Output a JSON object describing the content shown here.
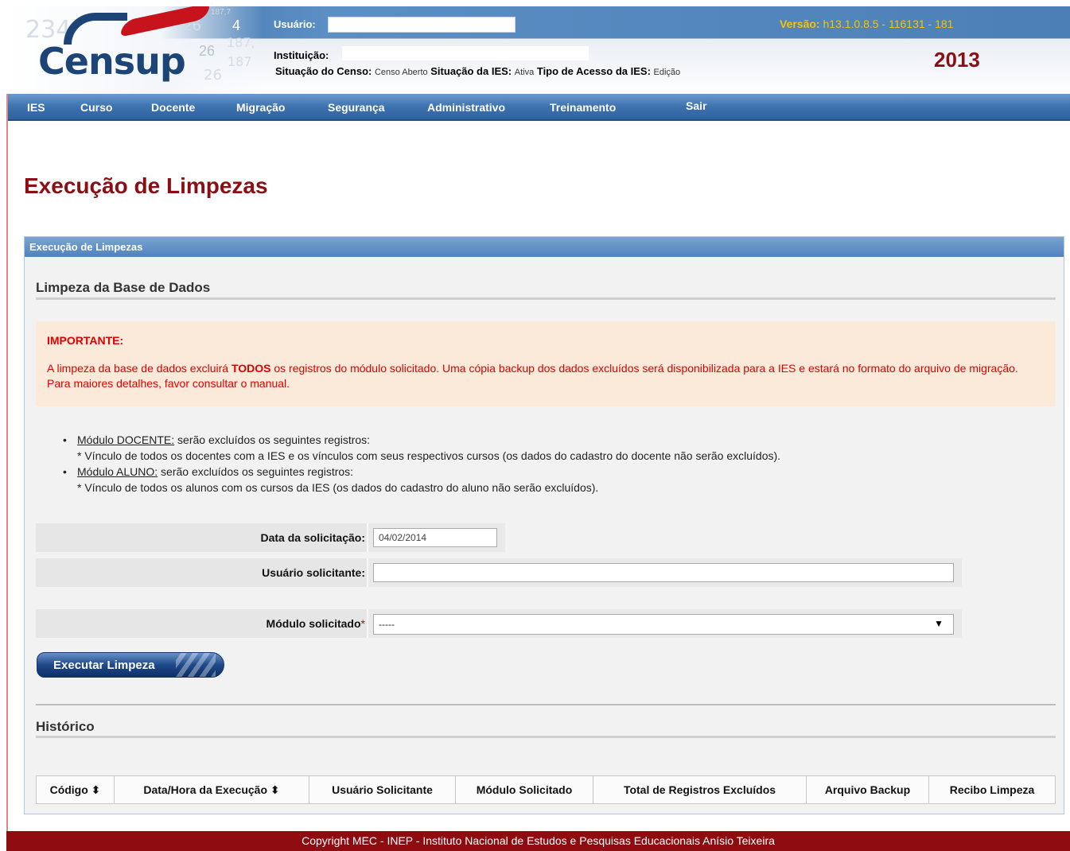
{
  "header": {
    "logo": {
      "brand": "Censup",
      "superscript": "26",
      "digits": [
        "234",
        "187,7",
        "4",
        "187,",
        "26",
        "187",
        "26"
      ]
    },
    "usuario_label": "Usuário:",
    "usuario_value": "",
    "instituicao_label": "Instituição:",
    "instituicao_value": "",
    "situacao_censo_label": "Situação do Censo:",
    "situacao_censo_value": "Censo Aberto",
    "situacao_ies_label": "Situação da IES:",
    "situacao_ies_value": "Ativa",
    "tipo_acesso_label": "Tipo de Acesso da IES:",
    "tipo_acesso_value": "Edição",
    "versao_label": "Versão:",
    "versao_value": "h13.1.0.8.5 - 116131 - 181",
    "year": "2013"
  },
  "nav": {
    "items": [
      "IES",
      "Curso",
      "Docente",
      "Migração",
      "Segurança",
      "Administrativo",
      "Treinamento",
      "Sair"
    ]
  },
  "page": {
    "title": "Execução de Limpezas"
  },
  "panel": {
    "header": "Execução de Limpezas",
    "section_title": "Limpeza da Base de Dados",
    "important": {
      "title": "IMPORTANTE:",
      "text_before": "A limpeza da base de dados excluirá ",
      "text_bold": "TODOS",
      "text_after": " os registros do módulo solicitado. Uma cópia backup dos dados excluídos será disponibilizada para a IES e estará no formato do arquivo de migração. Para maiores detalhes, favor consultar o manual."
    },
    "bullets": [
      {
        "module": "Módulo DOCENTE:",
        "intro": " serão excluídos os seguintes registros:",
        "detail": "* Vínculo de todos os docentes com a IES e os vínculos com seus respectivos cursos (os dados do cadastro do docente não serão excluídos)."
      },
      {
        "module": "Módulo ALUNO:",
        "intro": " serão excluídos os seguintes registros:",
        "detail": "* Vínculo de todos os alunos com os cursos da IES (os dados do cadastro do aluno não serão excluídos)."
      }
    ],
    "form": {
      "data_label": "Data da solicitação:",
      "data_value": "04/02/2014",
      "usuario_label": "Usuário solicitante:",
      "usuario_value": "",
      "modulo_label": "Módulo solicitado",
      "modulo_required_mark": "*",
      "modulo_selected": "-----"
    },
    "execute_button": "Executar Limpeza",
    "historico_title": "Histórico",
    "table_headers": [
      "Código ⬍",
      "Data/Hora da Execução ⬍",
      "Usuário Solicitante",
      "Módulo Solicitado",
      "Total de Registros Excluídos",
      "Arquivo Backup",
      "Recibo Limpeza"
    ]
  },
  "footer": {
    "text": "Copyright MEC - INEP - Instituto Nacional de Estudos e Pesquisas Educacionais Anísio Teixeira"
  },
  "colors": {
    "brand_red": "#8b0e14",
    "nav_blue": "#3d72ae",
    "important_bg": "#fbe9d9",
    "important_text": "#e00000",
    "version_yellow": "#f5c400"
  }
}
